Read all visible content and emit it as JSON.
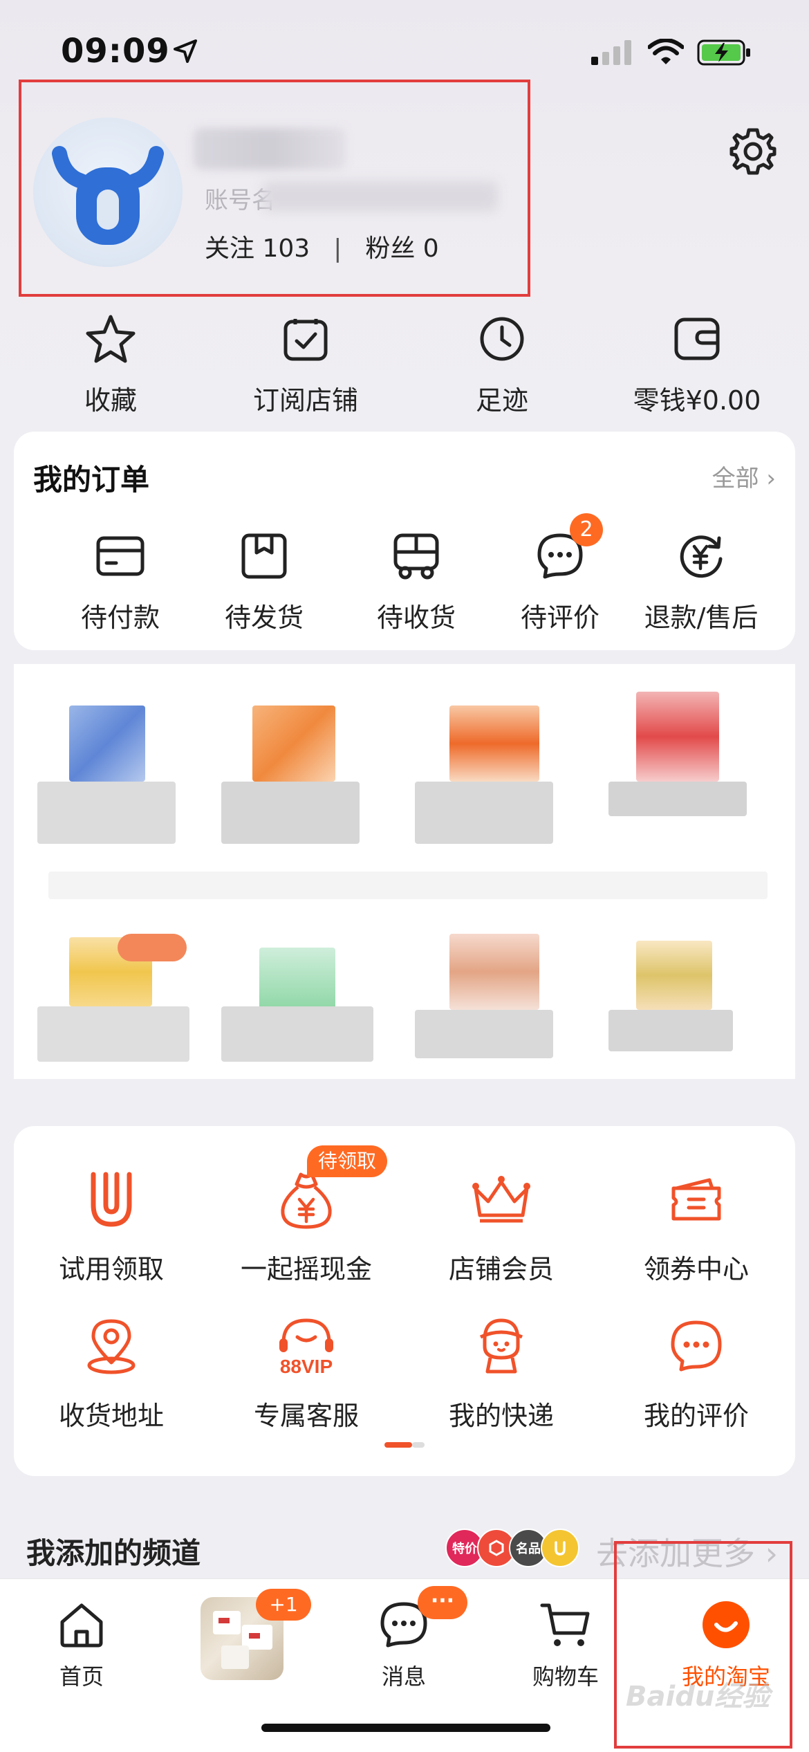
{
  "status_bar": {
    "time": "09:09"
  },
  "profile": {
    "follow_label": "关注",
    "follow_count": "103",
    "divider": "|",
    "fans_label": "粉丝",
    "fans_count": "0",
    "account_prefix": "账号名"
  },
  "quick_links": [
    {
      "label": "收藏",
      "icon": "star-icon"
    },
    {
      "label": "订阅店铺",
      "icon": "subscribe-check-icon"
    },
    {
      "label": "足迹",
      "icon": "clock-icon"
    },
    {
      "label": "零钱¥0.00",
      "icon": "wallet-icon"
    }
  ],
  "orders": {
    "title": "我的订单",
    "all_label": "全部 ›",
    "items": [
      {
        "label": "待付款",
        "icon": "card-icon"
      },
      {
        "label": "待发货",
        "icon": "box-icon"
      },
      {
        "label": "待收货",
        "icon": "truck-icon"
      },
      {
        "label": "待评价",
        "icon": "comment-icon",
        "badge": "2"
      },
      {
        "label": "退款/售后",
        "icon": "refund-icon"
      }
    ]
  },
  "services": {
    "items": [
      {
        "label": "试用领取",
        "icon": "trial-u-icon"
      },
      {
        "label": "一起摇现金",
        "icon": "money-bag-icon",
        "badge": "待领取"
      },
      {
        "label": "店铺会员",
        "icon": "crown-icon"
      },
      {
        "label": "领券中心",
        "icon": "coupon-icon"
      },
      {
        "label": "收货地址",
        "icon": "location-icon"
      },
      {
        "label": "专属客服",
        "icon": "headset-88vip-icon",
        "sub": "88VIP"
      },
      {
        "label": "我的快递",
        "icon": "courier-icon"
      },
      {
        "label": "我的评价",
        "icon": "review-icon"
      }
    ]
  },
  "channels": {
    "title": "我添加的频道",
    "more_label": "去添加更多 ›",
    "chips": [
      "特价",
      "",
      "名品",
      ""
    ]
  },
  "tabbar": {
    "tabs": [
      {
        "label": "首页",
        "icon": "home-icon"
      },
      {
        "label": "",
        "icon": "product-thumbnail",
        "badge": "+1"
      },
      {
        "label": "消息",
        "icon": "message-icon",
        "badge": "···"
      },
      {
        "label": "购物车",
        "icon": "cart-icon"
      },
      {
        "label": "我的淘宝",
        "icon": "my-taobao-icon",
        "active": true
      }
    ]
  },
  "colors": {
    "accent": "#ff5000",
    "badge": "#ff6a23",
    "highlight_box": "#e23d3d"
  },
  "watermark": "Baidu经验"
}
